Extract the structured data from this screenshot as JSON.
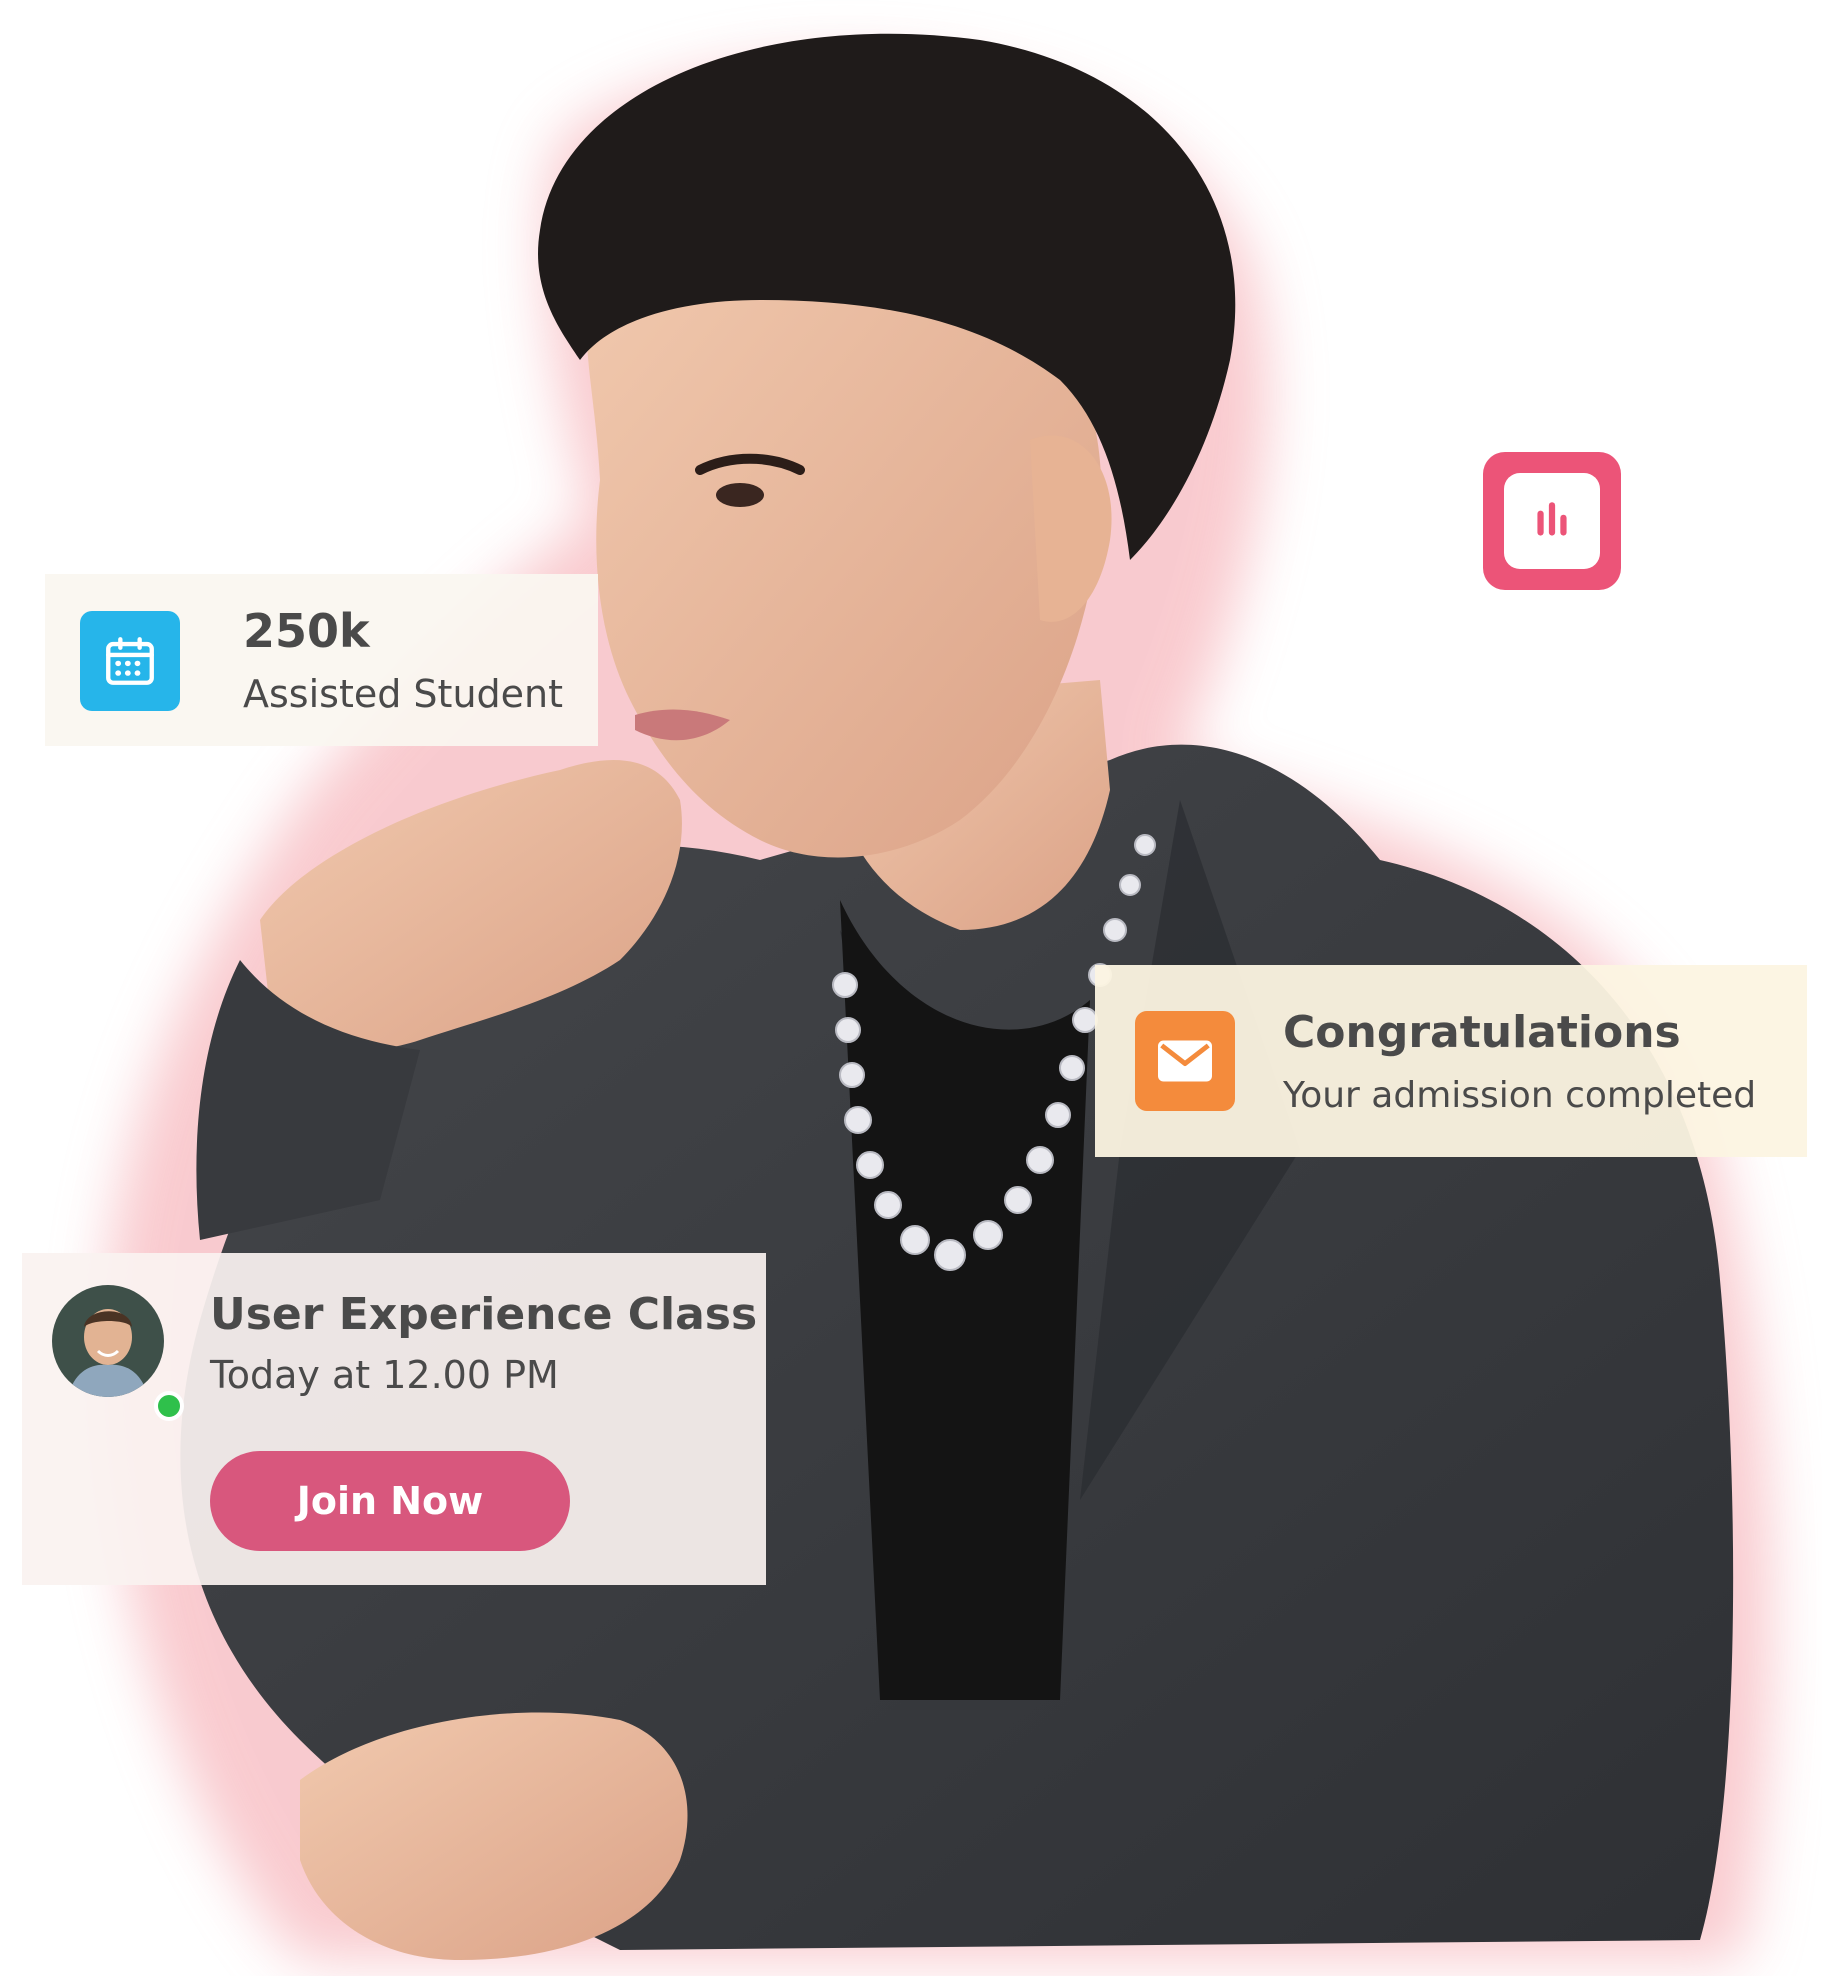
{
  "colors": {
    "glow": "#f4a0a8",
    "stat_icon_bg": "#26b5ea",
    "mail_icon_bg": "#f48b3c",
    "join_button_bg": "#d8577d",
    "chart_badge_bg": "#ec5478",
    "online_status": "#2fc04b"
  },
  "stat_card": {
    "icon": "calendar-icon",
    "value": "250k",
    "label": "Assisted Student"
  },
  "notification_card": {
    "icon": "mail-icon",
    "title": "Congratulations",
    "message": "Your admission completed"
  },
  "class_card": {
    "avatar": "instructor-avatar",
    "status": "online",
    "title": "User Experience Class",
    "time": "Today at 12.00 PM",
    "button_label": "Join Now"
  },
  "chart_badge": {
    "icon": "bar-chart-icon"
  }
}
